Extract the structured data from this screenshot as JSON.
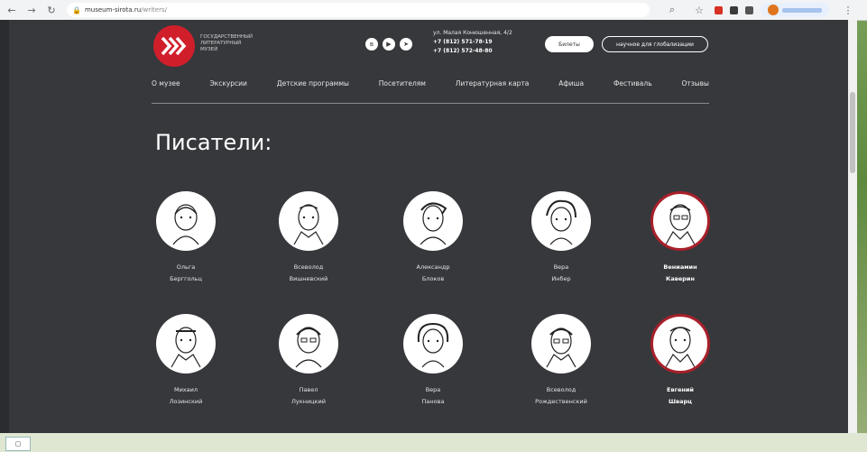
{
  "browser": {
    "url_host": "museum-sirota.ru",
    "url_path": "/writers/"
  },
  "header": {
    "logo_lines": [
      "ГОСУДАРСТВЕННЫЙ",
      "ЛИТЕРАТУРНЫЙ",
      "МУЗЕЙ"
    ],
    "address": "ул. Малая Конюшенная, 4/2",
    "phone1": "+7 (812) 571-78-19",
    "phone2": "+7 (812) 572-48-80",
    "button_primary": "Билеты",
    "button_secondary": "научное для глобализации"
  },
  "menu": [
    "О музее",
    "Экскурсии",
    "Детские программы",
    "Посетителям",
    "Литературная карта",
    "Афиша",
    "Фестиваль",
    "Отзывы"
  ],
  "page_title": "Писатели:",
  "writers": [
    {
      "line1": "Ольга",
      "line2": "Берггольц",
      "featured": false
    },
    {
      "line1": "Всеволод",
      "line2": "Вишневский",
      "featured": false
    },
    {
      "line1": "Александр",
      "line2": "Блоков",
      "featured": false
    },
    {
      "line1": "Вера",
      "line2": "Инбер",
      "featured": false
    },
    {
      "line1": "Вениамин",
      "line2": "Каверин",
      "featured": true
    },
    {
      "line1": "Михаил",
      "line2": "Лозинский",
      "featured": false
    },
    {
      "line1": "Павел",
      "line2": "Лукницкий",
      "featured": false
    },
    {
      "line1": "Вера",
      "line2": "Панова",
      "featured": false
    },
    {
      "line1": "Всеволод",
      "line2": "Рождественский",
      "featured": false
    },
    {
      "line1": "Евгений",
      "line2": "Шварц",
      "featured": true
    }
  ],
  "footer": {
    "button": ""
  }
}
